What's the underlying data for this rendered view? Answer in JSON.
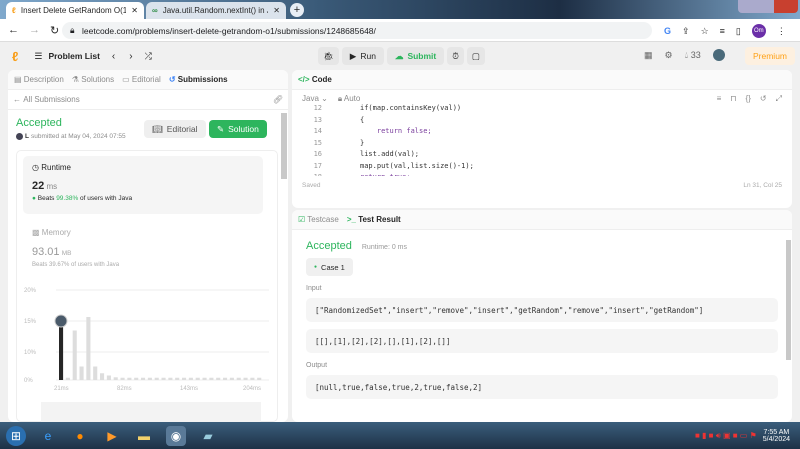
{
  "browser": {
    "tabs": [
      {
        "title": "Insert Delete GetRandom O(1) - ",
        "active": true
      },
      {
        "title": "Java.util.Random.nextInt() in Java",
        "active": false
      }
    ],
    "url": "leetcode.com/problems/insert-delete-getrandom-o1/submissions/1248685648/",
    "profile_initials": "Om"
  },
  "nav": {
    "problem_list": "Problem List",
    "run": "Run",
    "submit": "Submit",
    "streak": "33",
    "premium": "Premium"
  },
  "left": {
    "tabs": [
      "Description",
      "Solutions",
      "Editorial",
      "Submissions"
    ],
    "back": "All Submissions",
    "status": "Accepted",
    "user": "L",
    "submitted": "submitted at May 04, 2024 07:55",
    "editorial_btn": "Editorial",
    "solution_btn": "Solution",
    "runtime": {
      "label": "Runtime",
      "value": "22",
      "unit": "ms",
      "beats_prefix": "Beats",
      "beats": "99.38%",
      "beats_suffix": "of users with Java"
    },
    "memory": {
      "label": "Memory",
      "value": "93.01",
      "unit": "MB",
      "beats": "Beats 39.67% of users with Java"
    }
  },
  "chart_data": {
    "type": "bar",
    "title": "Runtime distribution",
    "y_ticks": [
      "20%",
      "15%",
      "10%",
      "0%"
    ],
    "x_ticks": [
      "21ms",
      "82ms",
      "143ms",
      "204ms"
    ],
    "ylim": [
      0,
      20
    ],
    "highlight": "22ms",
    "values": [
      14,
      0.5,
      11,
      3,
      14,
      3,
      1.5,
      1,
      0.6,
      0.5,
      0.5,
      0.5,
      0.5,
      0.5,
      0.5,
      0.5,
      0.5,
      0.5,
      0.5,
      0.5,
      0.5,
      0.5,
      0.5,
      0.5,
      0.5,
      0.5,
      0.5,
      0.5,
      0.5,
      0.5
    ]
  },
  "code": {
    "title": "Code",
    "language": "Java",
    "mode": "Auto",
    "lines": [
      {
        "n": "12",
        "t": "if(map.containsKey(val))"
      },
      {
        "n": "13",
        "t": "{"
      },
      {
        "n": "14",
        "t": "    return false;"
      },
      {
        "n": "15",
        "t": "}"
      },
      {
        "n": "16",
        "t": "list.add(val);"
      },
      {
        "n": "17",
        "t": "map.put(val,list.size()-1);"
      },
      {
        "n": "18",
        "t": "return true;"
      }
    ],
    "saved": "Saved",
    "cursor": "Ln 31, Col 25"
  },
  "result": {
    "tabs": [
      "Testcase",
      "Test Result"
    ],
    "status": "Accepted",
    "runtime": "Runtime: 0 ms",
    "case": "Case 1",
    "input_label": "Input",
    "input1": "[\"RandomizedSet\",\"insert\",\"remove\",\"insert\",\"getRandom\",\"remove\",\"insert\",\"getRandom\"]",
    "input2": "[[],[1],[2],[2],[],[1],[2],[]]",
    "output_label": "Output",
    "output": "[null,true,false,true,2,true,false,2]"
  },
  "taskbar": {
    "time": "7:55 AM",
    "date": "5/4/2024"
  }
}
